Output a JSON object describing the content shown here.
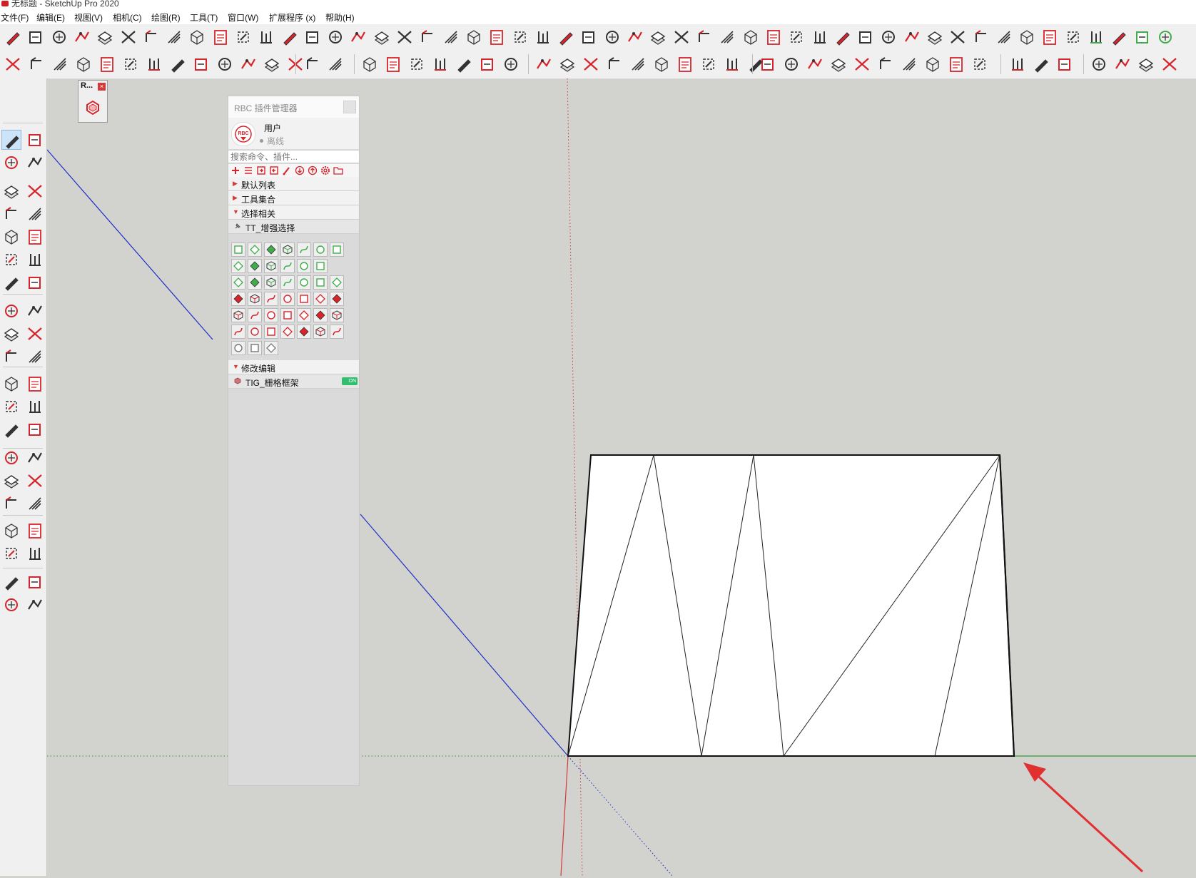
{
  "window": {
    "title": "无标题 - SketchUp Pro 2020"
  },
  "menu": [
    {
      "label": "文件(F)"
    },
    {
      "label": "编辑(E)"
    },
    {
      "label": "视图(V)"
    },
    {
      "label": "相机(C)"
    },
    {
      "label": "绘图(R)"
    },
    {
      "label": "工具(T)"
    },
    {
      "label": "窗口(W)"
    },
    {
      "label": "扩展程序 (x)"
    },
    {
      "label": "帮助(H)"
    }
  ],
  "mini_panel": {
    "title": "R...",
    "close": "×"
  },
  "plugin_panel": {
    "title": "RBC 插件管理器",
    "logo_text": "RBC",
    "user_label": "用户",
    "user_status": "离线",
    "search_placeholder": "搜索命令、插件...",
    "sections": [
      {
        "label": "默认列表",
        "expanded": false
      },
      {
        "label": "工具集合",
        "expanded": false
      },
      {
        "label": "选择相关",
        "expanded": true
      },
      {
        "label": "TT_增强选择",
        "sub": true
      },
      {
        "label": "修改编辑",
        "expanded": true
      },
      {
        "label": "TIG_栅格框架",
        "sub": true,
        "toggle": "ON"
      }
    ],
    "tt_grid_icons": [
      "select-face-icon",
      "select-edge-icon",
      "select-face-filled-icon",
      "select-box-icon",
      "select-group-icon",
      "select-points-icon",
      "select-lines-icon",
      "text-icon",
      "select-image-icon",
      "select-3d-icon",
      "select-curve-icon",
      "select-arc-icon",
      "select-circle-icon",
      "select-zigzag-icon",
      "select-hexagon-icon",
      "select-dim-icon",
      "select-cup-icon",
      "select-up-icon",
      "select-down-icon",
      "select-box-gray-icon",
      "select-box-gray2-icon",
      "select-box-gray3-icon",
      "deselect-face-icon",
      "deselect-face-filled-icon",
      "deselect-box-icon",
      "deselect-group-icon",
      "deselect-lines-icon",
      "deselect-points-icon",
      "deselect-text-icon",
      "deselect-image-icon",
      "deselect-3d-icon",
      "deselect-curve-icon",
      "deselect-curve2-icon",
      "deselect-arc-icon",
      "deselect-circle-icon",
      "deselect-zigzag-icon",
      "deselect-hexagon-icon",
      "deselect-dim-icon",
      "deselect-cup-icon",
      "deselect-up-icon",
      "deselect-diamond-icon",
      "invert-box-icon",
      "invert-box2-icon",
      "invert-box3-icon"
    ]
  },
  "colors": {
    "axis_red": "#d23b3b",
    "axis_green": "#2f9a2f",
    "axis_blue": "#1f2fc8",
    "viewport_bg": "#d2d2cf",
    "toolbar_bg": "#f0f0f0",
    "accent_red": "#d8232a",
    "plugin_green": "#3fae4a"
  }
}
